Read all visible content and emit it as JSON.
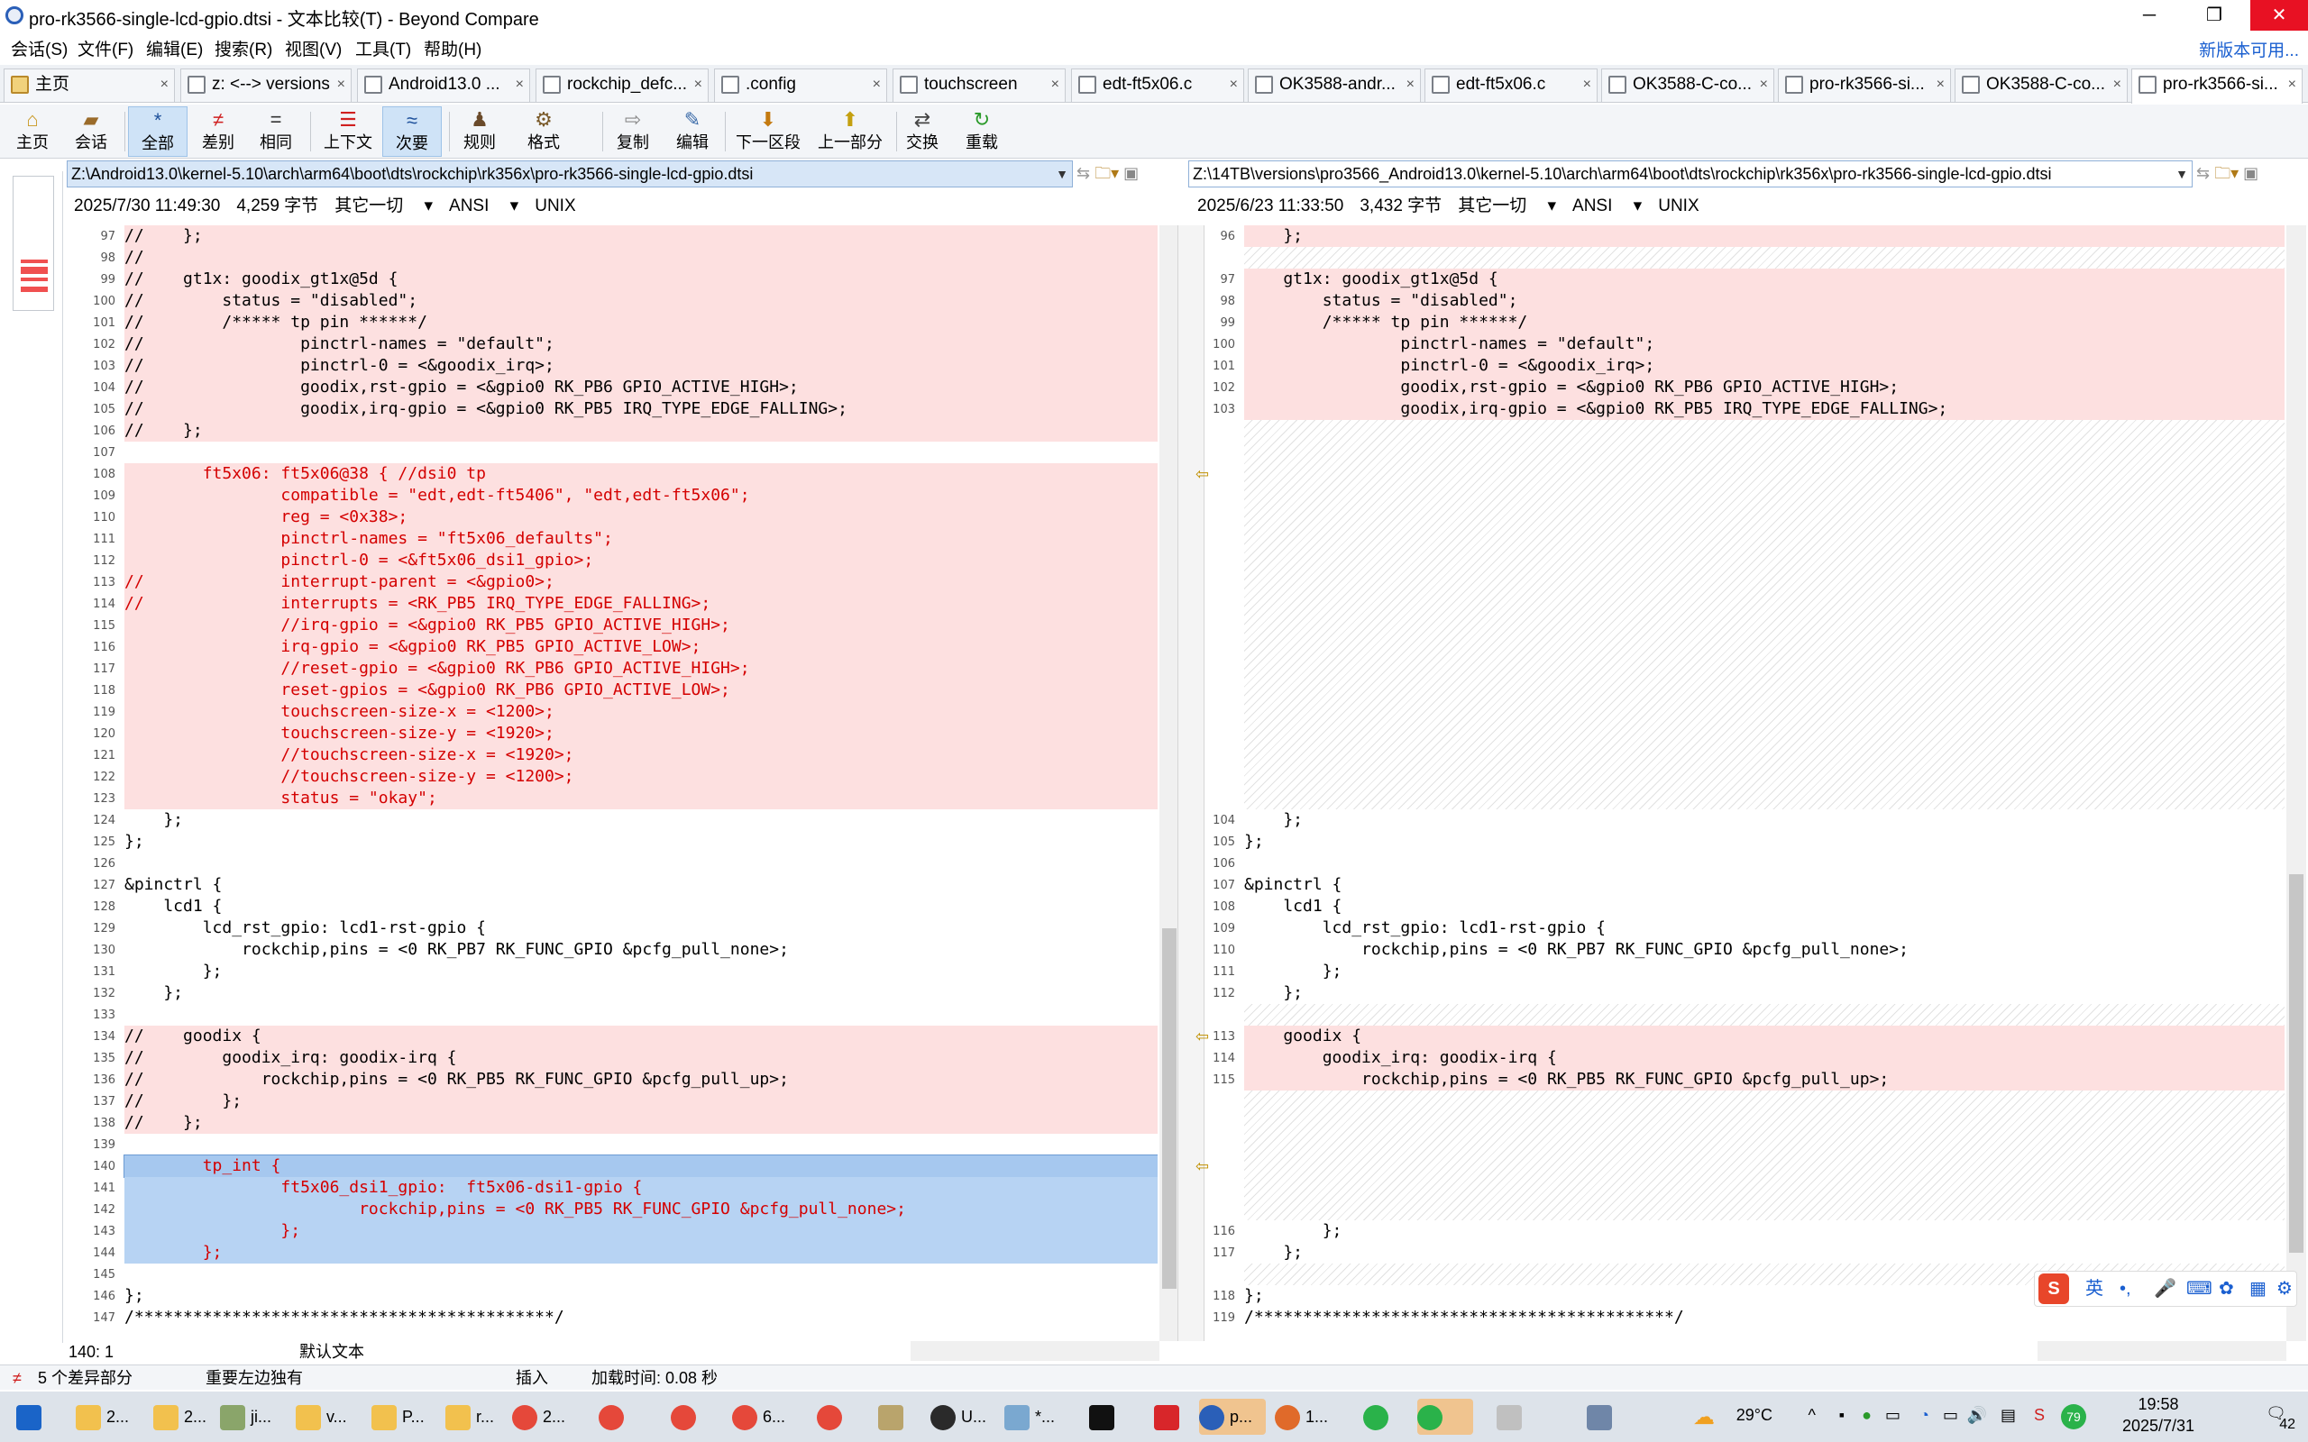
{
  "window": {
    "title": "pro-rk3566-single-lcd-gpio.dtsi - 文本比较(T) - Beyond Compare",
    "min": "─",
    "max": "❐",
    "close": "✕"
  },
  "menu": {
    "items": [
      "会话(S)",
      "文件(F)",
      "编辑(E)",
      "搜索(R)",
      "视图(V)",
      "工具(T)",
      "帮助(H)"
    ],
    "update_link": "新版本可用..."
  },
  "tabs": [
    {
      "label": "主页",
      "icon": "home-icon"
    },
    {
      "label": "z: <--> versions",
      "icon": "folder-compare-icon"
    },
    {
      "label": "Android13.0 ...",
      "icon": "folder-compare-icon"
    },
    {
      "label": "rockchip_defc...",
      "icon": "file-compare-icon"
    },
    {
      "label": ".config",
      "icon": "file-compare-icon"
    },
    {
      "label": "touchscreen",
      "icon": "folder-compare-icon"
    },
    {
      "label": "edt-ft5x06.c",
      "icon": "file-compare-icon"
    },
    {
      "label": "OK3588-andr...",
      "icon": "folder-compare-icon"
    },
    {
      "label": "edt-ft5x06.c",
      "icon": "file-compare-icon"
    },
    {
      "label": "OK3588-C-co...",
      "icon": "file-compare-icon"
    },
    {
      "label": "pro-rk3566-si...",
      "icon": "file-compare-icon"
    },
    {
      "label": "OK3588-C-co...",
      "icon": "file-compare-icon"
    },
    {
      "label": "pro-rk3566-si...",
      "icon": "file-compare-icon"
    }
  ],
  "tab_close": "×",
  "toolbar": {
    "home": "主页",
    "session": "会话",
    "all": "全部",
    "diffs": "差别",
    "same": "相同",
    "context": "上下文",
    "minor": "次要",
    "rules": "规则",
    "format": "格式",
    "copy": "复制",
    "edit": "编辑",
    "next_section": "下一区段",
    "prev_part": "上一部分",
    "swap": "交换",
    "reload": "重载"
  },
  "left": {
    "path": "Z:\\Android13.0\\kernel-5.10\\arch\\arm64\\boot\\dts\\rockchip\\rk356x\\pro-rk3566-single-lcd-gpio.dtsi",
    "date": "2025/7/30 11:49:30",
    "size": "4,259 字节",
    "filter": "其它一切",
    "encoding": "ANSI",
    "eol": "UNIX"
  },
  "right": {
    "path": "Z:\\14TB\\versions\\pro3566_Android13.0\\kernel-5.10\\arch\\arm64\\boot\\dts\\rockchip\\rk356x\\pro-rk3566-single-lcd-gpio.dtsi",
    "date": "2025/6/23 11:33:50",
    "size": "3,432 字节",
    "filter": "其它一切",
    "encoding": "ANSI",
    "eol": "UNIX"
  },
  "left_lines": [
    {
      "n": "97",
      "t": "//    };",
      "k": "diff"
    },
    {
      "n": "98",
      "t": "//",
      "k": "diff"
    },
    {
      "n": "99",
      "t": "//    gt1x: goodix_gt1x@5d {",
      "k": "diff"
    },
    {
      "n": "100",
      "t": "//        status = \"disabled\";",
      "k": "diff"
    },
    {
      "n": "101",
      "t": "//        /***** tp pin ******/",
      "k": "diff"
    },
    {
      "n": "102",
      "t": "//                pinctrl-names = \"default\";",
      "k": "diff"
    },
    {
      "n": "103",
      "t": "//                pinctrl-0 = <&goodix_irq>;",
      "k": "diff"
    },
    {
      "n": "104",
      "t": "//                goodix,rst-gpio = <&gpio0 RK_PB6 GPIO_ACTIVE_HIGH>;",
      "k": "diff"
    },
    {
      "n": "105",
      "t": "//                goodix,irq-gpio = <&gpio0 RK_PB5 IRQ_TYPE_EDGE_FALLING>;",
      "k": "diff"
    },
    {
      "n": "106",
      "t": "//    };",
      "k": "diff"
    },
    {
      "n": "107",
      "t": "",
      "k": "blank"
    },
    {
      "n": "108",
      "t": "        ft5x06: ft5x06@38 { //dsi0 tp",
      "k": "minor"
    },
    {
      "n": "109",
      "t": "                compatible = \"edt,edt-ft5406\", \"edt,edt-ft5x06\";",
      "k": "minor"
    },
    {
      "n": "110",
      "t": "                reg = <0x38>;",
      "k": "minor"
    },
    {
      "n": "111",
      "t": "                pinctrl-names = \"ft5x06_defaults\";",
      "k": "minor"
    },
    {
      "n": "112",
      "t": "                pinctrl-0 = <&ft5x06_dsi1_gpio>;",
      "k": "minor"
    },
    {
      "n": "113",
      "t": "//              interrupt-parent = <&gpio0>;",
      "k": "minor"
    },
    {
      "n": "114",
      "t": "//              interrupts = <RK_PB5 IRQ_TYPE_EDGE_FALLING>;",
      "k": "minor"
    },
    {
      "n": "115",
      "t": "                //irq-gpio = <&gpio0 RK_PB5 GPIO_ACTIVE_HIGH>;",
      "k": "minor"
    },
    {
      "n": "116",
      "t": "                irq-gpio = <&gpio0 RK_PB5 GPIO_ACTIVE_LOW>;",
      "k": "minor"
    },
    {
      "n": "117",
      "t": "                //reset-gpio = <&gpio0 RK_PB6 GPIO_ACTIVE_HIGH>;",
      "k": "minor"
    },
    {
      "n": "118",
      "t": "                reset-gpios = <&gpio0 RK_PB6 GPIO_ACTIVE_LOW>;",
      "k": "minor"
    },
    {
      "n": "119",
      "t": "                touchscreen-size-x = <1200>;",
      "k": "minor"
    },
    {
      "n": "120",
      "t": "                touchscreen-size-y = <1920>;",
      "k": "minor"
    },
    {
      "n": "121",
      "t": "                //touchscreen-size-x = <1920>;",
      "k": "minor"
    },
    {
      "n": "122",
      "t": "                //touchscreen-size-y = <1200>;",
      "k": "minor"
    },
    {
      "n": "123",
      "t": "                status = \"okay\";",
      "k": "minor"
    },
    {
      "n": "124",
      "t": "    };",
      "k": "plain"
    },
    {
      "n": "125",
      "t": "};",
      "k": "plain"
    },
    {
      "n": "126",
      "t": "",
      "k": "plain"
    },
    {
      "n": "127",
      "t": "&pinctrl {",
      "k": "plain"
    },
    {
      "n": "128",
      "t": "    lcd1 {",
      "k": "plain"
    },
    {
      "n": "129",
      "t": "        lcd_rst_gpio: lcd1-rst-gpio {",
      "k": "plain"
    },
    {
      "n": "130",
      "t": "            rockchip,pins = <0 RK_PB7 RK_FUNC_GPIO &pcfg_pull_none>;",
      "k": "plain"
    },
    {
      "n": "131",
      "t": "        };",
      "k": "plain"
    },
    {
      "n": "132",
      "t": "    };",
      "k": "plain"
    },
    {
      "n": "133",
      "t": "",
      "k": "plain"
    },
    {
      "n": "134",
      "t": "//    goodix {",
      "k": "diff"
    },
    {
      "n": "135",
      "t": "//        goodix_irq: goodix-irq {",
      "k": "diff"
    },
    {
      "n": "136",
      "t": "//            rockchip,pins = <0 RK_PB5 RK_FUNC_GPIO &pcfg_pull_up>;",
      "k": "diff"
    },
    {
      "n": "137",
      "t": "//        };",
      "k": "diff"
    },
    {
      "n": "138",
      "t": "//    };",
      "k": "diff"
    },
    {
      "n": "139",
      "t": "",
      "k": "plain"
    },
    {
      "n": "140",
      "t": "        tp_int {",
      "k": "cursor"
    },
    {
      "n": "141",
      "t": "                ft5x06_dsi1_gpio:  ft5x06-dsi1-gpio {",
      "k": "sel"
    },
    {
      "n": "142",
      "t": "                        rockchip,pins = <0 RK_PB5 RK_FUNC_GPIO &pcfg_pull_none>;",
      "k": "sel"
    },
    {
      "n": "143",
      "t": "                };",
      "k": "sel"
    },
    {
      "n": "144",
      "t": "        };",
      "k": "sel"
    },
    {
      "n": "145",
      "t": "",
      "k": "plain"
    },
    {
      "n": "146",
      "t": "};",
      "k": "plain"
    },
    {
      "n": "147",
      "t": "/*******************************************/",
      "k": "plain"
    }
  ],
  "right_lines": [
    {
      "row": 0,
      "n": "96",
      "t": "    };",
      "k": "diff"
    },
    {
      "row": 2,
      "n": "97",
      "t": "    gt1x: goodix_gt1x@5d {",
      "k": "diff"
    },
    {
      "row": 3,
      "n": "98",
      "t": "        status = \"disabled\";",
      "k": "diff"
    },
    {
      "row": 4,
      "n": "99",
      "t": "        /***** tp pin ******/",
      "k": "diff"
    },
    {
      "row": 5,
      "n": "100",
      "t": "                pinctrl-names = \"default\";",
      "k": "diff"
    },
    {
      "row": 6,
      "n": "101",
      "t": "                pinctrl-0 = <&goodix_irq>;",
      "k": "diff"
    },
    {
      "row": 7,
      "n": "102",
      "t": "                goodix,rst-gpio = <&gpio0 RK_PB6 GPIO_ACTIVE_HIGH>;",
      "k": "diff"
    },
    {
      "row": 8,
      "n": "103",
      "t": "                goodix,irq-gpio = <&gpio0 RK_PB5 IRQ_TYPE_EDGE_FALLING>;",
      "k": "diff"
    },
    {
      "row": 27,
      "n": "104",
      "t": "    };",
      "k": "plain"
    },
    {
      "row": 28,
      "n": "105",
      "t": "};",
      "k": "plain"
    },
    {
      "row": 29,
      "n": "106",
      "t": "",
      "k": "plain"
    },
    {
      "row": 30,
      "n": "107",
      "t": "&pinctrl {",
      "k": "plain"
    },
    {
      "row": 31,
      "n": "108",
      "t": "    lcd1 {",
      "k": "plain"
    },
    {
      "row": 32,
      "n": "109",
      "t": "        lcd_rst_gpio: lcd1-rst-gpio {",
      "k": "plain"
    },
    {
      "row": 33,
      "n": "110",
      "t": "            rockchip,pins = <0 RK_PB7 RK_FUNC_GPIO &pcfg_pull_none>;",
      "k": "plain"
    },
    {
      "row": 34,
      "n": "111",
      "t": "        };",
      "k": "plain"
    },
    {
      "row": 35,
      "n": "112",
      "t": "    };",
      "k": "plain"
    },
    {
      "row": 37,
      "n": "113",
      "t": "    goodix {",
      "k": "diff"
    },
    {
      "row": 38,
      "n": "114",
      "t": "        goodix_irq: goodix-irq {",
      "k": "diff"
    },
    {
      "row": 39,
      "n": "115",
      "t": "            rockchip,pins = <0 RK_PB5 RK_FUNC_GPIO &pcfg_pull_up>;",
      "k": "diff"
    },
    {
      "row": 46,
      "n": "116",
      "t": "        };",
      "k": "plain"
    },
    {
      "row": 47,
      "n": "117",
      "t": "    };",
      "k": "plain"
    },
    {
      "row": 49,
      "n": "118",
      "t": "};",
      "k": "plain"
    },
    {
      "row": 50,
      "n": "119",
      "t": "/*******************************************/",
      "k": "plain"
    }
  ],
  "position": {
    "cursor": "140: 1",
    "text_type": "默认文本"
  },
  "status": {
    "diff_count": "5 个差异部分",
    "importance": "重要左边独有",
    "mode": "插入",
    "load_time": "加载时间: 0.08 秒"
  },
  "ime": {
    "lang": "英",
    "punct": "•,"
  },
  "taskbar": {
    "items": [
      "2...",
      "2...",
      "ji...",
      "v...",
      "P...",
      "r...",
      "2...",
      "6...",
      "U...",
      "*...",
      "p...",
      "1..."
    ],
    "weather": "29°C",
    "time": "19:58",
    "date": "2025/7/31",
    "badge": "42",
    "battery": "79"
  },
  "colors": {
    "diff_bg": "#fde0e0",
    "minor_text": "#d40000",
    "selection_bg": "#b7d3f3"
  }
}
